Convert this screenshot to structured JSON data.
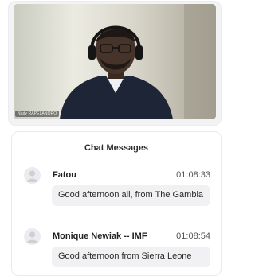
{
  "video": {
    "participant_name": "Nady RAPELANORO"
  },
  "chat": {
    "title": "Chat Messages",
    "messages": [
      {
        "sender": "Fatou",
        "time": "01:08:33",
        "text": "Good afternoon all, from The Gambia"
      },
      {
        "sender": "Monique Newiak -- IMF",
        "time": "01:08:54",
        "text": "Good afternoon from Sierra Leone"
      }
    ]
  },
  "colors": {
    "panel_border": "#e9e9ee",
    "bubble_background": "#f1f1f4",
    "avatar_background": "#ececf0"
  },
  "icons": {
    "avatar": "user-avatar-icon"
  }
}
